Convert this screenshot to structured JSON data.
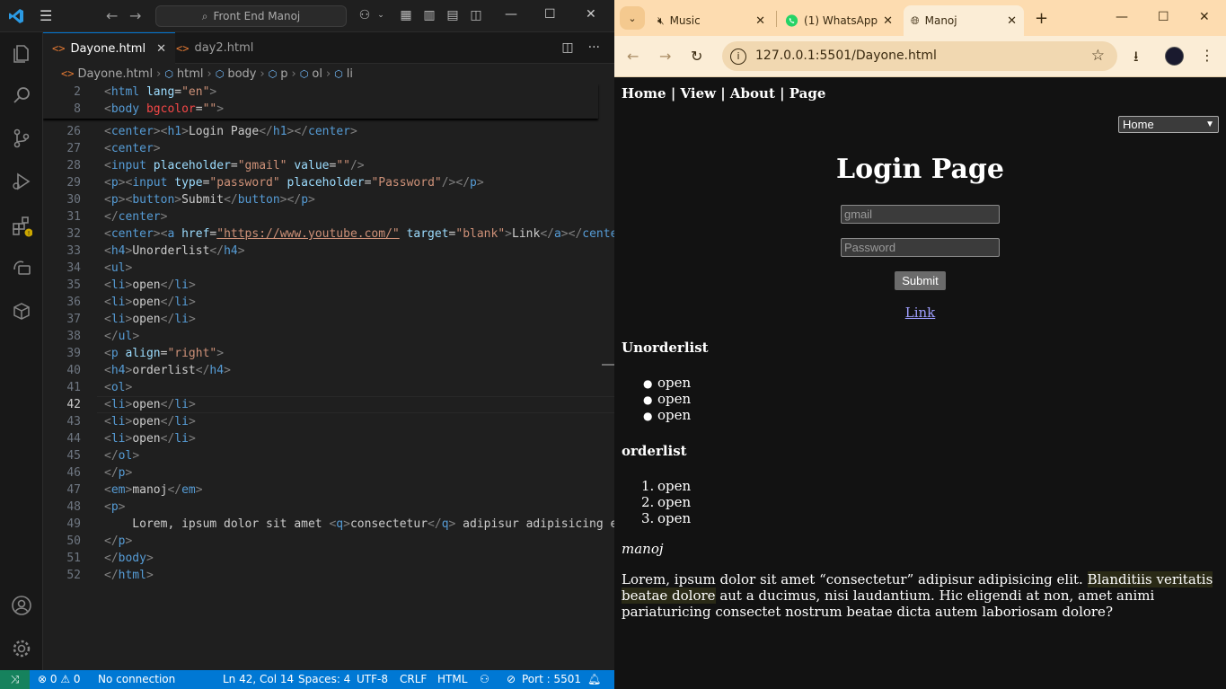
{
  "vscode": {
    "search_text": "Front End Manoj",
    "tabs": [
      {
        "label": "Dayone.html",
        "icon": "<>"
      },
      {
        "label": "day2.html",
        "icon": "<>"
      }
    ],
    "breadcrumb": [
      "Dayone.html",
      "html",
      "body",
      "p",
      "ol",
      "li"
    ],
    "sticky_lines": [
      {
        "num": "2",
        "parts": [
          [
            "pun",
            "<"
          ],
          [
            "tag",
            "html"
          ],
          [
            "t",
            " "
          ],
          [
            "attr",
            "lang"
          ],
          [
            "eq",
            "="
          ],
          [
            "str",
            "\"en\""
          ],
          [
            "pun",
            ">"
          ]
        ]
      },
      {
        "num": "8",
        "parts": [
          [
            "pun",
            "<"
          ],
          [
            "tag",
            "body"
          ],
          [
            "t",
            " "
          ],
          [
            "hl",
            "bgcolor"
          ],
          [
            "eq",
            "="
          ],
          [
            "str",
            "\"\""
          ],
          [
            "pun",
            ">"
          ]
        ]
      }
    ],
    "lines": [
      {
        "num": "26",
        "parts": [
          [
            "pun",
            "<"
          ],
          [
            "tag",
            "center"
          ],
          [
            "pun",
            "><"
          ],
          [
            "tag",
            "h1"
          ],
          [
            "pun",
            ">"
          ],
          [
            "t",
            "Login Page"
          ],
          [
            "pun",
            "</"
          ],
          [
            "tag",
            "h1"
          ],
          [
            "pun",
            "></"
          ],
          [
            "tag",
            "center"
          ],
          [
            "pun",
            ">"
          ]
        ]
      },
      {
        "num": "27",
        "parts": [
          [
            "pun",
            "<"
          ],
          [
            "tag",
            "center"
          ],
          [
            "pun",
            ">"
          ]
        ]
      },
      {
        "num": "28",
        "parts": [
          [
            "pun",
            "<"
          ],
          [
            "tag",
            "input"
          ],
          [
            "t",
            " "
          ],
          [
            "attr",
            "placeholder"
          ],
          [
            "eq",
            "="
          ],
          [
            "str",
            "\"gmail\""
          ],
          [
            "t",
            " "
          ],
          [
            "attr",
            "value"
          ],
          [
            "eq",
            "="
          ],
          [
            "str",
            "\"\""
          ],
          [
            "pun",
            "/>"
          ]
        ]
      },
      {
        "num": "29",
        "parts": [
          [
            "pun",
            "<"
          ],
          [
            "tag",
            "p"
          ],
          [
            "pun",
            "><"
          ],
          [
            "tag",
            "input"
          ],
          [
            "t",
            " "
          ],
          [
            "attr",
            "type"
          ],
          [
            "eq",
            "="
          ],
          [
            "str",
            "\"password\""
          ],
          [
            "t",
            " "
          ],
          [
            "attr",
            "placeholder"
          ],
          [
            "eq",
            "="
          ],
          [
            "str",
            "\"Password\""
          ],
          [
            "pun",
            "/></"
          ],
          [
            "tag",
            "p"
          ],
          [
            "pun",
            ">"
          ]
        ]
      },
      {
        "num": "30",
        "parts": [
          [
            "pun",
            "<"
          ],
          [
            "tag",
            "p"
          ],
          [
            "pun",
            "><"
          ],
          [
            "tag",
            "button"
          ],
          [
            "pun",
            ">"
          ],
          [
            "t",
            "Submit"
          ],
          [
            "pun",
            "</"
          ],
          [
            "tag",
            "button"
          ],
          [
            "pun",
            "></"
          ],
          [
            "tag",
            "p"
          ],
          [
            "pun",
            ">"
          ]
        ]
      },
      {
        "num": "31",
        "parts": [
          [
            "pun",
            "</"
          ],
          [
            "tag",
            "center"
          ],
          [
            "pun",
            ">"
          ]
        ]
      },
      {
        "num": "32",
        "parts": [
          [
            "pun",
            "<"
          ],
          [
            "tag",
            "center"
          ],
          [
            "pun",
            "><"
          ],
          [
            "tag",
            "a"
          ],
          [
            "t",
            " "
          ],
          [
            "attr",
            "href"
          ],
          [
            "eq",
            "="
          ],
          [
            "url",
            "\"https://www.youtube.com/\""
          ],
          [
            "t",
            " "
          ],
          [
            "attr",
            "target"
          ],
          [
            "eq",
            "="
          ],
          [
            "str",
            "\"blank\""
          ],
          [
            "pun",
            ">"
          ],
          [
            "t",
            "Link"
          ],
          [
            "pun",
            "</"
          ],
          [
            "tag",
            "a"
          ],
          [
            "pun",
            "></"
          ],
          [
            "tag",
            "center"
          ]
        ]
      },
      {
        "num": "33",
        "parts": [
          [
            "pun",
            "<"
          ],
          [
            "tag",
            "h4"
          ],
          [
            "pun",
            ">"
          ],
          [
            "t",
            "Unorderlist"
          ],
          [
            "pun",
            "</"
          ],
          [
            "tag",
            "h4"
          ],
          [
            "pun",
            ">"
          ]
        ]
      },
      {
        "num": "34",
        "parts": [
          [
            "pun",
            "<"
          ],
          [
            "tag",
            "ul"
          ],
          [
            "pun",
            ">"
          ]
        ]
      },
      {
        "num": "35",
        "parts": [
          [
            "pun",
            "<"
          ],
          [
            "tag",
            "li"
          ],
          [
            "pun",
            ">"
          ],
          [
            "t",
            "open"
          ],
          [
            "pun",
            "</"
          ],
          [
            "tag",
            "li"
          ],
          [
            "pun",
            ">"
          ]
        ]
      },
      {
        "num": "36",
        "parts": [
          [
            "pun",
            "<"
          ],
          [
            "tag",
            "li"
          ],
          [
            "pun",
            ">"
          ],
          [
            "t",
            "open"
          ],
          [
            "pun",
            "</"
          ],
          [
            "tag",
            "li"
          ],
          [
            "pun",
            ">"
          ]
        ]
      },
      {
        "num": "37",
        "parts": [
          [
            "pun",
            "<"
          ],
          [
            "tag",
            "li"
          ],
          [
            "pun",
            ">"
          ],
          [
            "t",
            "open"
          ],
          [
            "pun",
            "</"
          ],
          [
            "tag",
            "li"
          ],
          [
            "pun",
            ">"
          ]
        ]
      },
      {
        "num": "38",
        "parts": [
          [
            "pun",
            "</"
          ],
          [
            "tag",
            "ul"
          ],
          [
            "pun",
            ">"
          ]
        ]
      },
      {
        "num": "39",
        "parts": [
          [
            "pun",
            "<"
          ],
          [
            "tag",
            "p"
          ],
          [
            "t",
            " "
          ],
          [
            "attr",
            "align"
          ],
          [
            "eq",
            "="
          ],
          [
            "str",
            "\"right\""
          ],
          [
            "pun",
            ">"
          ]
        ]
      },
      {
        "num": "40",
        "parts": [
          [
            "pun",
            "<"
          ],
          [
            "tag",
            "h4"
          ],
          [
            "pun",
            ">"
          ],
          [
            "t",
            "orderlist"
          ],
          [
            "pun",
            "</"
          ],
          [
            "tag",
            "h4"
          ],
          [
            "pun",
            ">"
          ]
        ]
      },
      {
        "num": "41",
        "parts": [
          [
            "pun",
            "<"
          ],
          [
            "tag",
            "ol"
          ],
          [
            "pun",
            ">"
          ]
        ]
      },
      {
        "num": "42",
        "parts": [
          [
            "pun",
            "<"
          ],
          [
            "tag",
            "li"
          ],
          [
            "pun",
            ">"
          ],
          [
            "t",
            "open"
          ],
          [
            "pun",
            "</"
          ],
          [
            "tag",
            "li"
          ],
          [
            "pun",
            ">"
          ]
        ],
        "current": true
      },
      {
        "num": "43",
        "parts": [
          [
            "pun",
            "<"
          ],
          [
            "tag",
            "li"
          ],
          [
            "pun",
            ">"
          ],
          [
            "t",
            "open"
          ],
          [
            "pun",
            "</"
          ],
          [
            "tag",
            "li"
          ],
          [
            "pun",
            ">"
          ]
        ]
      },
      {
        "num": "44",
        "parts": [
          [
            "pun",
            "<"
          ],
          [
            "tag",
            "li"
          ],
          [
            "pun",
            ">"
          ],
          [
            "t",
            "open"
          ],
          [
            "pun",
            "</"
          ],
          [
            "tag",
            "li"
          ],
          [
            "pun",
            ">"
          ]
        ]
      },
      {
        "num": "45",
        "parts": [
          [
            "pun",
            "</"
          ],
          [
            "tag",
            "ol"
          ],
          [
            "pun",
            ">"
          ]
        ]
      },
      {
        "num": "46",
        "parts": [
          [
            "pun",
            "</"
          ],
          [
            "tag",
            "p"
          ],
          [
            "pun",
            ">"
          ]
        ]
      },
      {
        "num": "47",
        "parts": [
          [
            "pun",
            "<"
          ],
          [
            "tag",
            "em"
          ],
          [
            "pun",
            ">"
          ],
          [
            "t",
            "manoj"
          ],
          [
            "pun",
            "</"
          ],
          [
            "tag",
            "em"
          ],
          [
            "pun",
            ">"
          ]
        ]
      },
      {
        "num": "48",
        "parts": [
          [
            "pun",
            "<"
          ],
          [
            "tag",
            "p"
          ],
          [
            "pun",
            ">"
          ]
        ]
      },
      {
        "num": "49",
        "parts": [
          [
            "t",
            "    Lorem, ipsum dolor sit amet "
          ],
          [
            "pun",
            "<"
          ],
          [
            "tag",
            "q"
          ],
          [
            "pun",
            ">"
          ],
          [
            "t",
            "consectetur"
          ],
          [
            "pun",
            "</"
          ],
          [
            "tag",
            "q"
          ],
          [
            "pun",
            ">"
          ],
          [
            "t",
            " adipisur adipisicing el"
          ]
        ]
      },
      {
        "num": "50",
        "parts": [
          [
            "pun",
            "</"
          ],
          [
            "tag",
            "p"
          ],
          [
            "pun",
            ">"
          ]
        ]
      },
      {
        "num": "51",
        "parts": [
          [
            "pun",
            "</"
          ],
          [
            "tag",
            "body"
          ],
          [
            "pun",
            ">"
          ]
        ]
      },
      {
        "num": "52",
        "parts": [
          [
            "pun",
            "</"
          ],
          [
            "tag",
            "html"
          ],
          [
            "pun",
            ">"
          ]
        ]
      }
    ],
    "status": {
      "problems": "⊗ 0 ⚠ 0",
      "connection": "No connection",
      "position": "Ln 42, Col 14",
      "spaces": "Spaces: 4",
      "encoding": "UTF-8",
      "eol": "CRLF",
      "language": "HTML",
      "port": "Port : 5501"
    }
  },
  "browser": {
    "tabs": [
      {
        "label": "Music"
      },
      {
        "label": "(1) WhatsApp"
      },
      {
        "label": "Manoj"
      }
    ],
    "url": "127.0.0.1:5501/Dayone.html",
    "page": {
      "nav": "Home | View | About | Page",
      "select_value": "Home",
      "title": "Login Page",
      "email_placeholder": "gmail",
      "password_placeholder": "Password",
      "submit_label": "Submit",
      "link_text": "Link",
      "ul_heading": "Unorderlist",
      "ul_items": [
        "open",
        "open",
        "open"
      ],
      "ol_heading": "orderlist",
      "ol_items": [
        "open",
        "open",
        "open"
      ],
      "em_text": "manoj",
      "para_lead": "Lorem, ipsum dolor sit amet “consectetur” adipisur adipisicing elit. ",
      "para_hl": "Blanditiis veritatis beatae dolore",
      "para_rest": " aut a ducimus, nisi laudantium. Hic eligendi at non, amet animi pariaturicing consectet nostrum beatae dicta autem laboriosam dolore?"
    }
  },
  "colors": {
    "vscode_accent": "#0078d4",
    "chrome_frame": "#fddcb0",
    "page_bg": "#121212",
    "link": "#9e9eff"
  }
}
